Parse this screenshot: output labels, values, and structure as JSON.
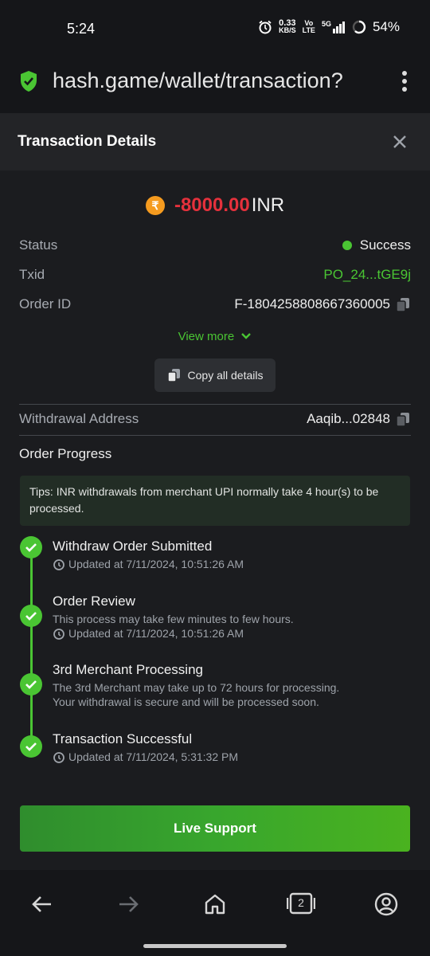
{
  "status_bar": {
    "time": "5:24",
    "net_speed_value": "0.33",
    "net_speed_unit": "KB/S",
    "volte": "Vo",
    "lte": "LTE",
    "signal": "5G",
    "battery": "54%"
  },
  "browser": {
    "url": "hash.game/wallet/transaction?",
    "tab_count": "2"
  },
  "dialog": {
    "title": "Transaction Details"
  },
  "amount": {
    "currency_symbol": "₹",
    "value": "-8000.00",
    "currency": "INR"
  },
  "details": {
    "status_label": "Status",
    "status_value": "Success",
    "txid_label": "Txid",
    "txid_value": "PO_24...tGE9j",
    "order_id_label": "Order ID",
    "order_id_value": "F-1804258808667360005",
    "view_more": "View more",
    "copy_all": "Copy all details",
    "withdrawal_label": "Withdrawal Address",
    "withdrawal_value": "Aaqib...02848"
  },
  "progress": {
    "title": "Order Progress",
    "tips": "Tips: INR withdrawals from merchant UPI normally take 4 hour(s) to be processed.",
    "steps": [
      {
        "title": "Withdraw Order Submitted",
        "updated": "Updated at 7/11/2024, 10:51:26 AM"
      },
      {
        "title": "Order Review",
        "note": "This process may take few minutes to few hours.",
        "updated": "Updated at 7/11/2024, 10:51:26 AM"
      },
      {
        "title": "3rd Merchant Processing",
        "note1": "The 3rd Merchant may take up to 72 hours for processing.",
        "note2": "Your withdrawal is secure and will be processed soon."
      },
      {
        "title": "Transaction Successful",
        "updated": "Updated at 7/11/2024, 5:31:32 PM"
      }
    ]
  },
  "live_support": "Live Support",
  "colors": {
    "accent_green": "#4ac533",
    "negative_red": "#e5313c",
    "rupee_orange": "#f59b1f"
  }
}
